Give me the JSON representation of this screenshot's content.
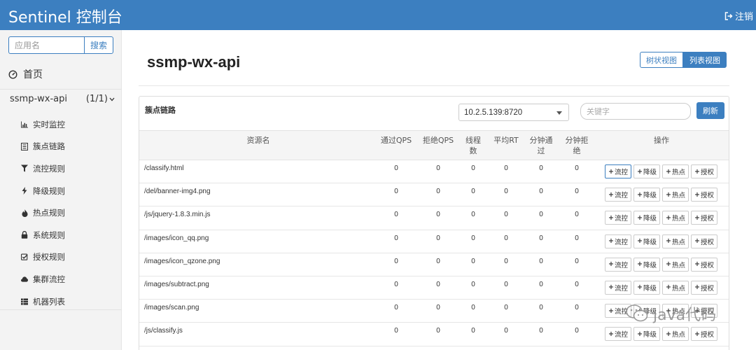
{
  "header": {
    "title": "Sentinel 控制台",
    "logout_label": "注销"
  },
  "sidebar": {
    "search_placeholder": "应用名",
    "search_button": "搜索",
    "home_label": "首页",
    "app_name": "ssmp-wx-api",
    "app_count": "(1/1)",
    "items": [
      {
        "label": "实时监控",
        "icon": "bar-chart-icon"
      },
      {
        "label": "簇点链路",
        "icon": "list-icon"
      },
      {
        "label": "流控规则",
        "icon": "filter-icon"
      },
      {
        "label": "降级规则",
        "icon": "flash-icon"
      },
      {
        "label": "热点规则",
        "icon": "fire-icon"
      },
      {
        "label": "系统规则",
        "icon": "lock-icon"
      },
      {
        "label": "授权规则",
        "icon": "check-icon"
      },
      {
        "label": "集群流控",
        "icon": "cloud-icon"
      },
      {
        "label": "机器列表",
        "icon": "th-list-icon"
      }
    ]
  },
  "main": {
    "title": "ssmp-wx-api",
    "view_tree": "树状视图",
    "view_list": "列表视图",
    "panel_label": "簇点链路",
    "machine": "10.2.5.139:8720",
    "keyword_placeholder": "关键字",
    "refresh": "刷新",
    "columns": {
      "resource": "资源名",
      "pass_qps": "通过QPS",
      "block_qps": "拒绝QPS",
      "threads": "线程\n数",
      "avg_rt": "平均RT",
      "minute_pass": "分钟通\n过",
      "minute_block": "分钟拒\n绝",
      "ops": "操作"
    },
    "op_labels": {
      "flow": "流控",
      "degrade": "降级",
      "hot": "热点",
      "auth": "授权"
    },
    "rows": [
      {
        "resource": "/classify.html",
        "pass_qps": "0",
        "block_qps": "0",
        "threads": "0",
        "avg_rt": "0",
        "minute_pass": "0",
        "minute_block": "0"
      },
      {
        "resource": "/del/banner-img4.png",
        "pass_qps": "0",
        "block_qps": "0",
        "threads": "0",
        "avg_rt": "0",
        "minute_pass": "0",
        "minute_block": "0"
      },
      {
        "resource": "/js/jquery-1.8.3.min.js",
        "pass_qps": "0",
        "block_qps": "0",
        "threads": "0",
        "avg_rt": "0",
        "minute_pass": "0",
        "minute_block": "0"
      },
      {
        "resource": "/images/icon_qq.png",
        "pass_qps": "0",
        "block_qps": "0",
        "threads": "0",
        "avg_rt": "0",
        "minute_pass": "0",
        "minute_block": "0"
      },
      {
        "resource": "/images/icon_qzone.png",
        "pass_qps": "0",
        "block_qps": "0",
        "threads": "0",
        "avg_rt": "0",
        "minute_pass": "0",
        "minute_block": "0"
      },
      {
        "resource": "/images/subtract.png",
        "pass_qps": "0",
        "block_qps": "0",
        "threads": "0",
        "avg_rt": "0",
        "minute_pass": "0",
        "minute_block": "0"
      },
      {
        "resource": "/images/scan.png",
        "pass_qps": "0",
        "block_qps": "0",
        "threads": "0",
        "avg_rt": "0",
        "minute_pass": "0",
        "minute_block": "0"
      },
      {
        "resource": "/js/classify.js",
        "pass_qps": "0",
        "block_qps": "0",
        "threads": "0",
        "avg_rt": "0",
        "minute_pass": "0",
        "minute_block": "0"
      }
    ]
  },
  "watermark": "java代码",
  "colors": {
    "primary": "#3c7fc0",
    "sidebar_bg": "#f3f3f3",
    "table_header_bg": "#f5f5f5"
  }
}
